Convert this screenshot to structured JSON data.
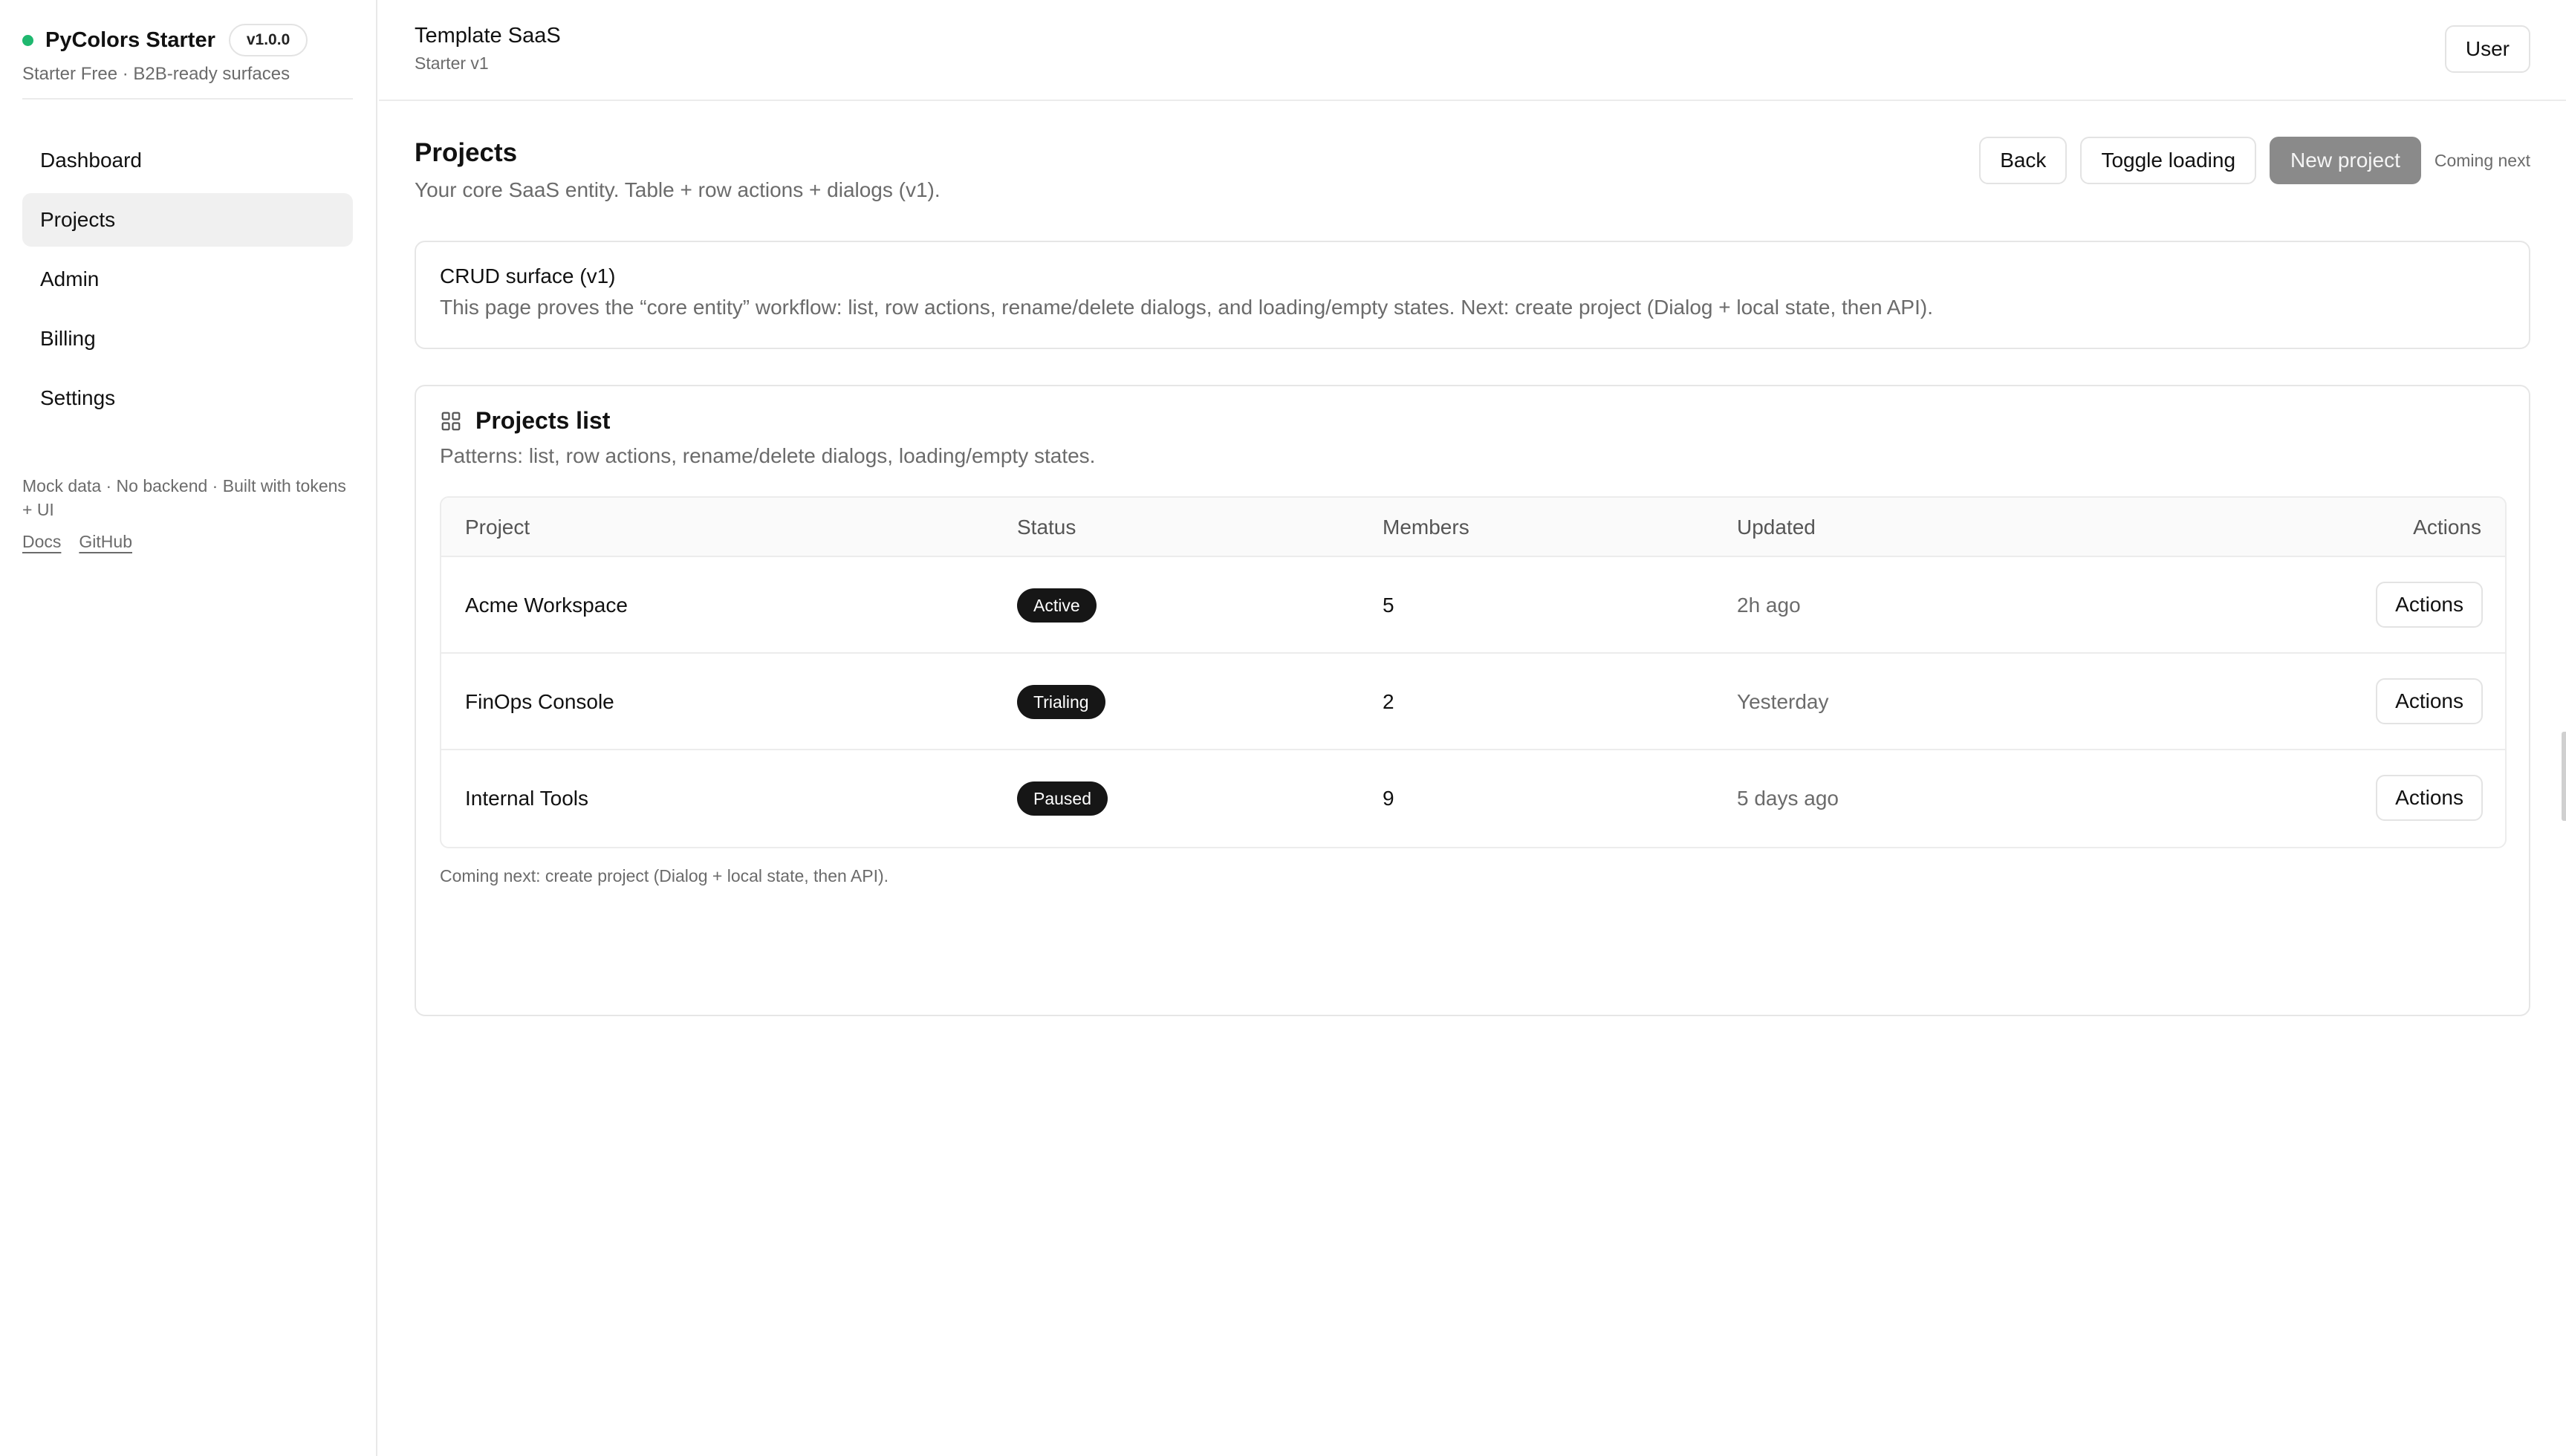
{
  "brand": {
    "name": "PyColors Starter",
    "version": "v1.0.0",
    "subtitle": "Starter Free · B2B-ready surfaces",
    "status_color": "#1fb86f"
  },
  "sidebar": {
    "items": [
      {
        "label": "Dashboard",
        "active": false
      },
      {
        "label": "Projects",
        "active": true
      },
      {
        "label": "Admin",
        "active": false
      },
      {
        "label": "Billing",
        "active": false
      },
      {
        "label": "Settings",
        "active": false
      }
    ],
    "footer_note": "Mock data · No backend · Built with tokens + UI",
    "links": [
      {
        "label": "Docs"
      },
      {
        "label": "GitHub"
      }
    ]
  },
  "topbar": {
    "title": "Template SaaS",
    "subtitle": "Starter v1",
    "user_label": "User"
  },
  "page": {
    "title": "Projects",
    "description": "Your core SaaS entity. Table + row actions + dialogs (v1).",
    "actions": {
      "back": "Back",
      "toggle_loading": "Toggle loading",
      "new_project": "New project",
      "coming_next": "Coming next"
    }
  },
  "crud_card": {
    "title": "CRUD surface (v1)",
    "description": "This page proves the “core entity” workflow: list, row actions, rename/delete dialogs, and loading/empty states. Next: create project (Dialog + local state, then API)."
  },
  "projects_list": {
    "icon": "grid-icon",
    "title": "Projects list",
    "description": "Patterns: list, row actions, rename/delete dialogs, loading/empty states.",
    "columns": {
      "project": "Project",
      "status": "Status",
      "members": "Members",
      "updated": "Updated",
      "actions": "Actions"
    },
    "rows": [
      {
        "name": "Acme Workspace",
        "status": "Active",
        "members": "5",
        "updated": "2h ago",
        "action": "Actions"
      },
      {
        "name": "FinOps Console",
        "status": "Trialing",
        "members": "2",
        "updated": "Yesterday",
        "action": "Actions"
      },
      {
        "name": "Internal Tools",
        "status": "Paused",
        "members": "9",
        "updated": "5 days ago",
        "action": "Actions"
      }
    ],
    "footer": "Coming next: create project (Dialog + local state, then API)."
  }
}
